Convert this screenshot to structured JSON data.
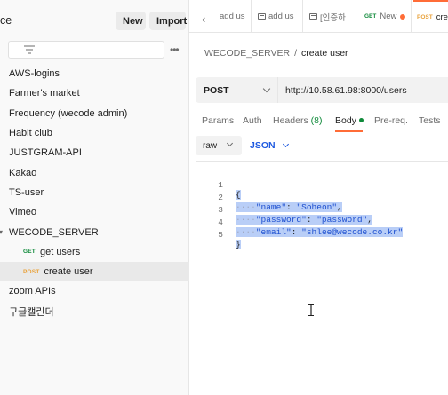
{
  "sidebar": {
    "title": "ce",
    "new_label": "New",
    "import_label": "Import",
    "more_label": "•••",
    "collections": [
      {
        "label": "AWS-logins"
      },
      {
        "label": "Farmer's market"
      },
      {
        "label": "Frequency (wecode admin)"
      },
      {
        "label": "Habit club"
      },
      {
        "label": "JUSTGRAM-API"
      },
      {
        "label": "Kakao"
      },
      {
        "label": "TS-user"
      },
      {
        "label": "Vimeo"
      },
      {
        "label": "WECODE_SERVER"
      }
    ],
    "requests": [
      {
        "method": "GET",
        "label": "get users"
      },
      {
        "method": "POST",
        "label": "create user"
      }
    ],
    "after": [
      {
        "label": "zoom APIs"
      },
      {
        "label": "구글캘린더"
      }
    ]
  },
  "tabs": [
    {
      "label": "add us"
    },
    {
      "label": "add us"
    },
    {
      "label": "[인증하"
    },
    {
      "method": "GET",
      "label": "New"
    },
    {
      "method": "POST",
      "label": "cre"
    }
  ],
  "breadcrumb": {
    "parent": "WECODE_SERVER",
    "separator": "/",
    "current": "create user"
  },
  "request": {
    "method": "POST",
    "url": "http://10.58.61.98:8000/users"
  },
  "request_tabs": {
    "params": "Params",
    "auth": "Auth",
    "headers": "Headers",
    "headers_count": "(8)",
    "body": "Body",
    "prereq": "Pre-req.",
    "tests": "Tests"
  },
  "body_options": {
    "mode": "raw",
    "language": "JSON"
  },
  "code": {
    "line_numbers": [
      "1",
      "2",
      "3",
      "4",
      "5"
    ],
    "open_brace": "{",
    "close_brace": "}",
    "fields": [
      {
        "key": "\"name\"",
        "colon": ": ",
        "value": "\"Soheon\"",
        "trail": ","
      },
      {
        "key": "\"password\"",
        "colon": ": ",
        "value": "\"password\"",
        "trail": ","
      },
      {
        "key": "\"email\"",
        "colon": ": ",
        "value": "\"shlee@wecode.co.kr\"",
        "trail": ""
      }
    ],
    "indent": "····"
  },
  "colors": {
    "accent": "#ff6c37",
    "get": "#0f8a3a",
    "post": "#e9a23b",
    "json": "#1f5ae0",
    "selection": "#b9cef7"
  }
}
